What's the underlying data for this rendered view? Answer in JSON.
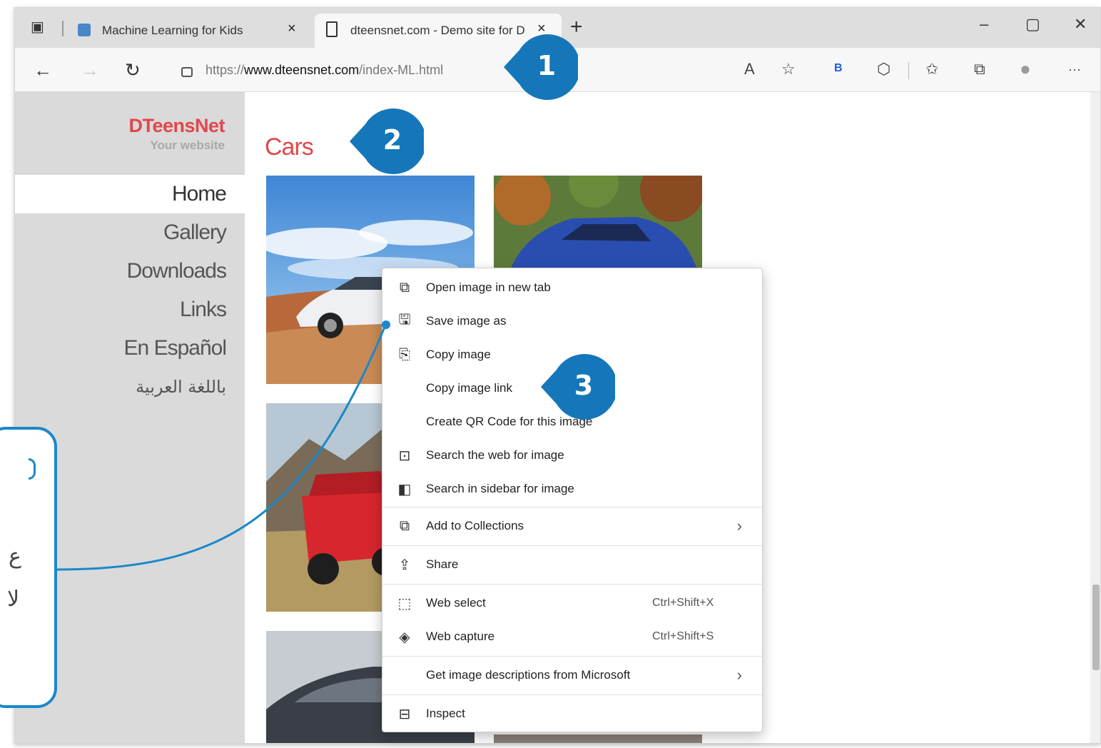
{
  "browser": {
    "tabs": [
      {
        "label": "Machine Learning for Kids",
        "close": "×"
      },
      {
        "label": "dteensnet.com - Demo site for D",
        "close": "×"
      }
    ],
    "new_tab": "+",
    "window_controls": {
      "minimize": "–",
      "maximize": "▢",
      "close": "✕"
    },
    "url": {
      "scheme": "https://",
      "host": "www.dteensnet.com",
      "path": "/index-ML.html"
    },
    "nav": {
      "back": "←",
      "forward": "→",
      "refresh": "↻"
    },
    "toolbar_icons": [
      "read-aloud-icon",
      "favorite-add-icon",
      "bing-icon",
      "extensions-icon",
      "favorites-icon",
      "collections-icon",
      "profile-icon",
      "more-icon"
    ],
    "toolbar_glyphs": {
      "read_aloud": "A",
      "fav_add": "☆",
      "bing": "B",
      "ext": "⬡",
      "favorites": "✩",
      "collections": "⧉",
      "profile": "●",
      "more": "···"
    }
  },
  "site": {
    "brand_name": "DTeensNet",
    "brand_tagline": "Your website",
    "nav": [
      "Home",
      "Gallery",
      "Downloads",
      "Links",
      "En Español",
      "باللغة العربية"
    ],
    "active_nav": "Home",
    "heading": "Cars"
  },
  "context_menu": {
    "items": [
      {
        "label": "Open image in new tab",
        "icon": "open-in-new-tab-icon",
        "glyph": "⧉"
      },
      {
        "label": "Save image as",
        "icon": "save-image-icon",
        "glyph": "🖫"
      },
      {
        "label": "Copy image",
        "icon": "copy-image-icon",
        "glyph": "⎘"
      },
      {
        "label": "Copy image link",
        "icon": "",
        "glyph": ""
      },
      {
        "label": "Create QR Code for this image",
        "icon": "",
        "glyph": ""
      },
      {
        "label": "Search the web for image",
        "icon": "visual-search-icon",
        "glyph": "⊡"
      },
      {
        "label": "Search in sidebar for image",
        "icon": "sidebar-search-icon",
        "glyph": "◧"
      },
      {
        "label": "Add to Collections",
        "icon": "collections-icon",
        "glyph": "⧉",
        "submenu": "›"
      },
      {
        "label": "Share",
        "icon": "share-icon",
        "glyph": "⇪"
      },
      {
        "label": "Web select",
        "icon": "web-select-icon",
        "glyph": "⬚",
        "shortcut": "Ctrl+Shift+X"
      },
      {
        "label": "Web capture",
        "icon": "web-capture-icon",
        "glyph": "◈",
        "shortcut": "Ctrl+Shift+S"
      },
      {
        "label": "Get image descriptions from Microsoft",
        "icon": "",
        "glyph": "",
        "submenu": "›"
      },
      {
        "label": "Inspect",
        "icon": "inspect-icon",
        "glyph": "⊟"
      }
    ]
  },
  "callouts": [
    "1",
    "2",
    "3"
  ],
  "note": {
    "line1": "ع",
    "line2": "لا"
  },
  "colors": {
    "brand_red": "#e2474a",
    "callout_blue": "#1577ba",
    "note_border": "#1a88c9"
  }
}
